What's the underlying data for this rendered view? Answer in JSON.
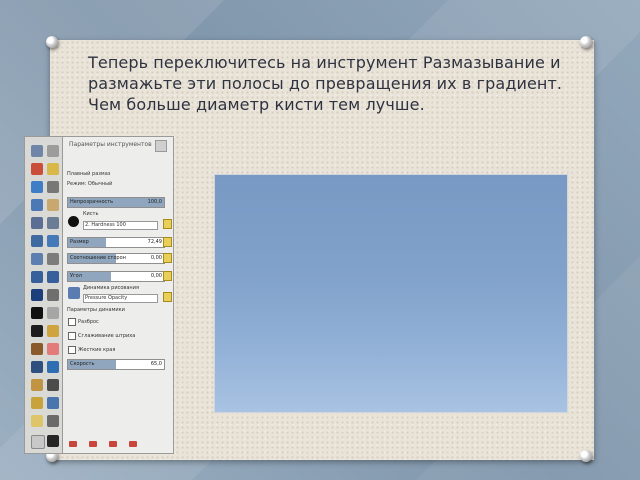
{
  "slide": {
    "instruction": "Теперь переключитесь на инструмент Размазывание и размажьте эти полосы до превращения их в градиент. Чем больше диаметр кисти тем лучше."
  },
  "tool_options": {
    "title": "Параметры инструментов",
    "blend_label": "Плавный размаз",
    "mode_label": "Режим: Обычный",
    "opacity": {
      "label": "Непрозрачность",
      "value": "100,0"
    },
    "brush": {
      "label": "Кисть",
      "name": "2. Hardness 100"
    },
    "size": {
      "label": "Размер",
      "value": "72,49"
    },
    "aspect": {
      "label": "Соотношение сторон",
      "value": "0,00"
    },
    "angle": {
      "label": "Угол",
      "value": "0,00"
    },
    "dynamics": {
      "label": "Динамика рисования",
      "name": "Pressure Opacity"
    },
    "dynamics_options": "Параметры динамики",
    "checkboxes": [
      "Разброс",
      "Сглаживание штриха",
      "Жесткие края"
    ],
    "rate": {
      "label": "Скорость",
      "value": "65,0"
    }
  },
  "colors": {
    "canvas_top": "#7799c3",
    "canvas_bottom": "#a8c3e2",
    "slide_bg": "#e9e3d8",
    "text": "#2f3340"
  },
  "icons": [
    "push-pin-icon",
    "toolbox-icons",
    "brush-preview-icon",
    "gimp-tool-icons"
  ]
}
